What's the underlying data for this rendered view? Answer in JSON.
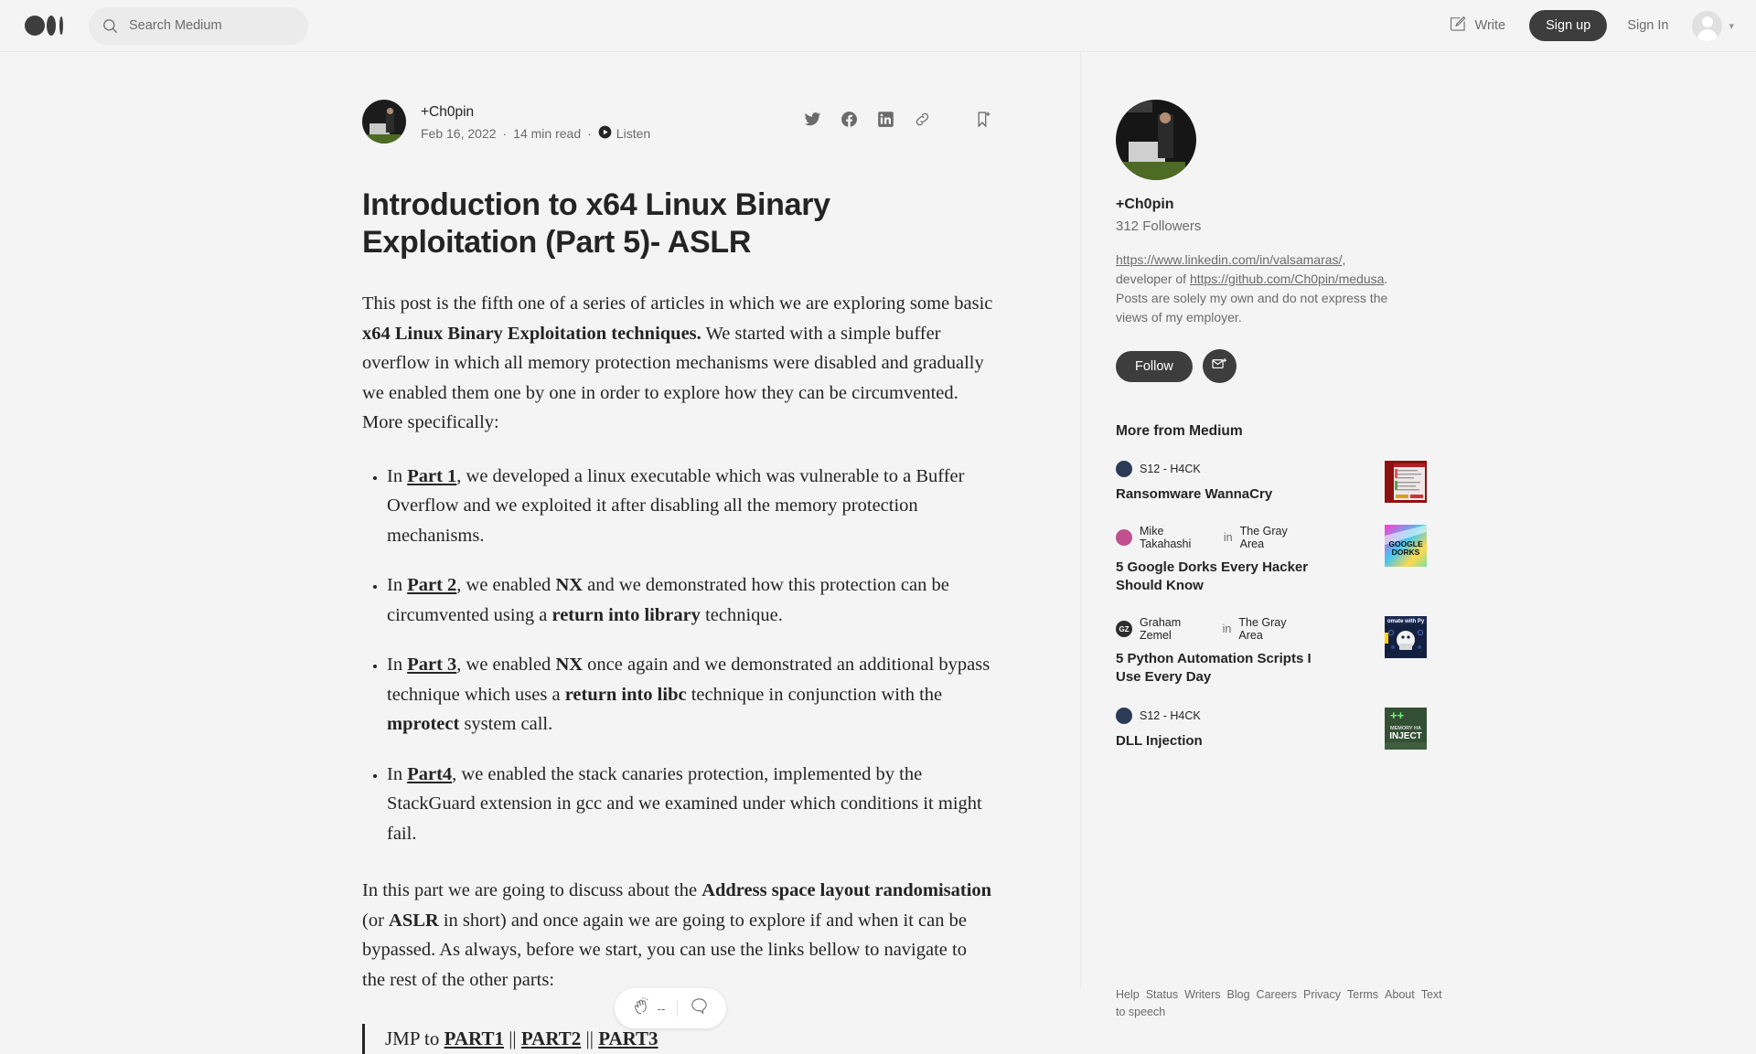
{
  "header": {
    "logo": "medium-logo",
    "search": {
      "placeholder": "Search Medium",
      "value": ""
    },
    "write_label": "Write",
    "signup_label": "Sign up",
    "signin_label": "Sign In"
  },
  "article": {
    "author": "+Ch0pin",
    "date": "Feb 16, 2022",
    "read_time": "14 min read",
    "listen_label": "Listen",
    "dot1": "·",
    "dot2": "·",
    "title": "Introduction to x64 Linux Binary Exploitation (Part 5)- ASLR",
    "intro_1": "This post is the fifth one of a series of articles in which we are exploring some basic ",
    "intro_bold": "x64 Linux Binary Exploitation techniques.",
    "intro_2": " We started with a simple buffer overflow in which all memory protection mechanisms were disabled and gradually we enabled them one by one in order to explore how they can be circumvented. More specifically:",
    "bullets": [
      {
        "pre": "In ",
        "link": "Part 1",
        "post": ", we developed a linux executable which was vulnerable to a Buffer Overflow and we exploited it after disabling all the memory protection mechanisms."
      },
      {
        "pre": "In ",
        "link": "Part 2",
        "mid1": ", we enabled ",
        "b1": "NX",
        "mid2": " and we demonstrated how this protection can be circumvented using a ",
        "b2": "return into library",
        "post": " technique."
      },
      {
        "pre": "In ",
        "link": "Part 3",
        "mid1": ", we enabled ",
        "b1": "NX",
        "mid2": " once again and we demonstrated an additional bypass technique which uses a ",
        "b2": "return into libc",
        "mid3": " technique in conjunction with the ",
        "b3": "mprotect",
        "post": " system call."
      },
      {
        "pre": "In ",
        "link": "Part4",
        "post": ", we enabled the stack canaries protection, implemented by the StackGuard extension in gcc and we examined under which conditions it might fail."
      }
    ],
    "closing_1": "In this part we are going to discuss about the ",
    "closing_b1": "Address space layout randomisation",
    "closing_2": " (or ",
    "closing_b2": "ASLR",
    "closing_3": " in short) and once again we are going to explore if and when it can be bypassed. As always, before we start, you can use the links bellow to navigate to the rest of the other parts:",
    "quote_pre": "JMP to ",
    "quote_links": [
      "PART1",
      "PART2",
      "PART3"
    ],
    "quote_sep": " || "
  },
  "float_widget": {
    "clap_icon": "clap-icon",
    "clap_count": "--",
    "comment_icon": "comment-icon"
  },
  "sidebar": {
    "name": "+Ch0pin",
    "followers": "312 Followers",
    "bio_link1": "https://www.linkedin.com/in/valsamaras/",
    "bio_text1": ", developer of ",
    "bio_link2": "https://github.com/Ch0pin/medusa",
    "bio_text2": ". Posts are solely my own and do not express the views of my employer.",
    "follow_label": "Follow",
    "mail_icon": "mail-plus-icon",
    "more_title": "More from Medium",
    "more_items": [
      {
        "author": "S12 - H4CK",
        "publication": "",
        "in_word": "",
        "title": "Ransomware WannaCry",
        "thumb": "wannacry-screenshot",
        "avatar_color": "#2b3a55",
        "avatar_initials": ""
      },
      {
        "author": "Mike Takahashi",
        "in_word": "in",
        "publication": "The Gray Area",
        "title": "5 Google Dorks Every Hacker Should Know",
        "thumb": "google-dorks-cover",
        "avatar_color": "#c0508f",
        "avatar_initials": ""
      },
      {
        "author": "Graham Zemel",
        "in_word": "in",
        "publication": "The Gray Area",
        "title": "5 Python Automation Scripts I Use Every Day",
        "thumb": "python-automation-cover",
        "avatar_color": "#2d2d2d",
        "avatar_initials": "GZ"
      },
      {
        "author": "S12 - H4CK",
        "publication": "",
        "in_word": "",
        "title": "DLL Injection",
        "thumb": "dll-injection-cover",
        "avatar_color": "#2b3a55",
        "avatar_initials": ""
      }
    ]
  },
  "footer": {
    "links": [
      "Help",
      "Status",
      "Writers",
      "Blog",
      "Careers",
      "Privacy",
      "Terms",
      "About"
    ],
    "tts": "Text to speech"
  },
  "colors": {
    "page_bg": "#f4f4f4",
    "text": "#242424",
    "muted": "#6b6b6b",
    "accent_dark": "#3d3d3d"
  }
}
